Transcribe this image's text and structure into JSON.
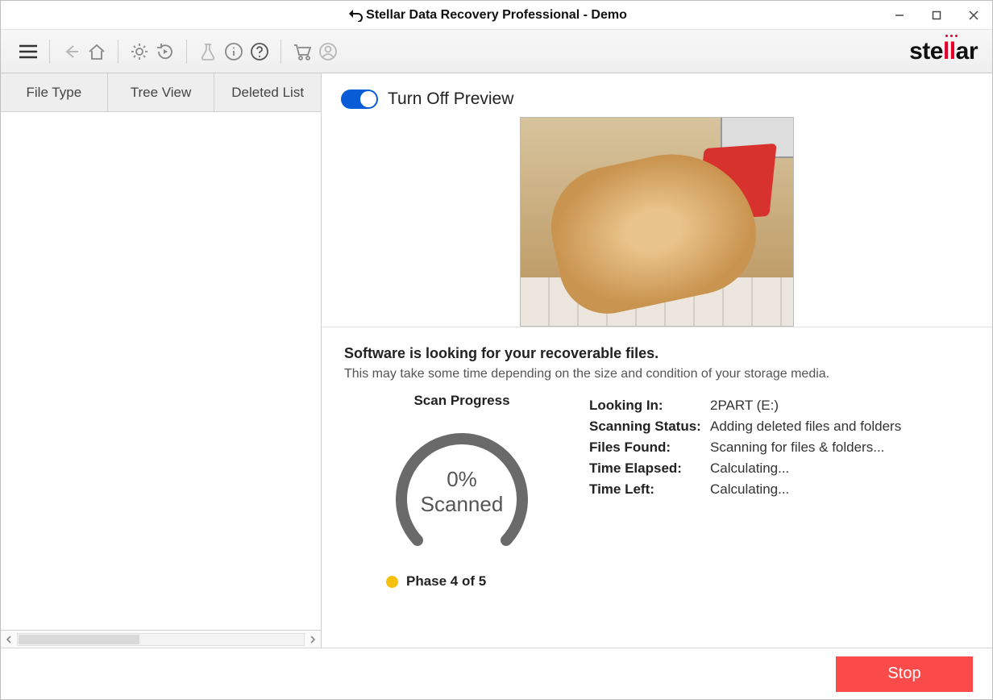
{
  "titlebar": {
    "title": "Stellar Data Recovery Professional - Demo"
  },
  "toolbar": {
    "icons": {
      "menu": "menu-icon",
      "back": "back-arrow-icon",
      "home": "home-icon",
      "settings": "gear-icon",
      "rewind": "resume-recovery-icon",
      "labs": "labs-icon",
      "info": "info-icon",
      "help": "help-icon",
      "cart": "cart-icon",
      "user": "user-icon"
    },
    "brand": "stellar"
  },
  "tabs": [
    {
      "id": "file-type",
      "label": "File Type"
    },
    {
      "id": "tree-view",
      "label": "Tree View"
    },
    {
      "id": "deleted-list",
      "label": "Deleted List"
    }
  ],
  "preview": {
    "toggle_label": "Turn Off Preview",
    "toggle_on": true
  },
  "status": {
    "heading": "Software is looking for your recoverable files.",
    "subheading": "This may take some time depending on the size and condition of your storage media.",
    "progress_label": "Scan Progress",
    "percent_value": "0%",
    "percent_sub": "Scanned",
    "rows": [
      {
        "k": "Looking In:",
        "v": "2PART (E:)"
      },
      {
        "k": "Scanning Status:",
        "v": "Adding deleted files and folders"
      },
      {
        "k": "Files Found:",
        "v": "Scanning for files & folders..."
      },
      {
        "k": "Time Elapsed:",
        "v": "Calculating..."
      },
      {
        "k": "Time Left:",
        "v": "Calculating..."
      }
    ],
    "phase": "Phase 4 of 5"
  },
  "footer": {
    "stop_label": "Stop"
  }
}
